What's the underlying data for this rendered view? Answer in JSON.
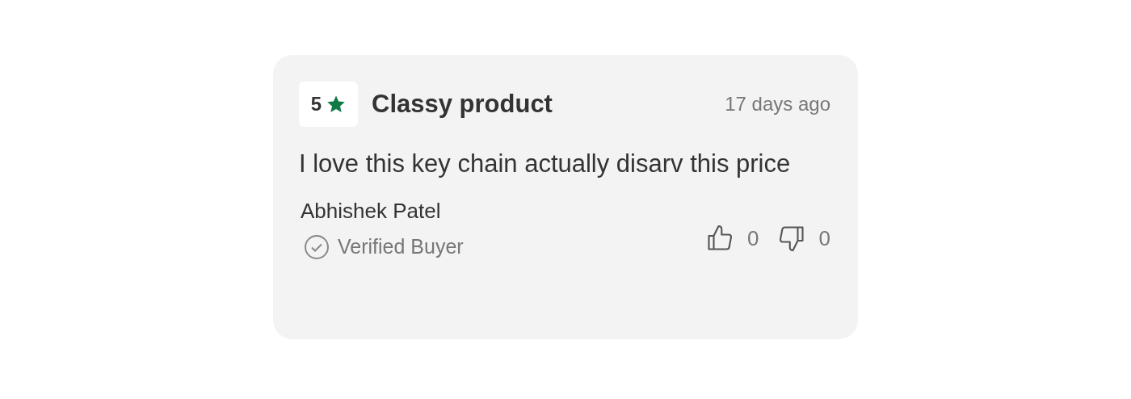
{
  "review": {
    "rating": "5",
    "title": "Classy product",
    "time": "17 days ago",
    "body": "I love this key chain actually disarv this price",
    "author": "Abhishek Patel",
    "verified_label": "Verified Buyer",
    "likes": "0",
    "dislikes": "0"
  }
}
